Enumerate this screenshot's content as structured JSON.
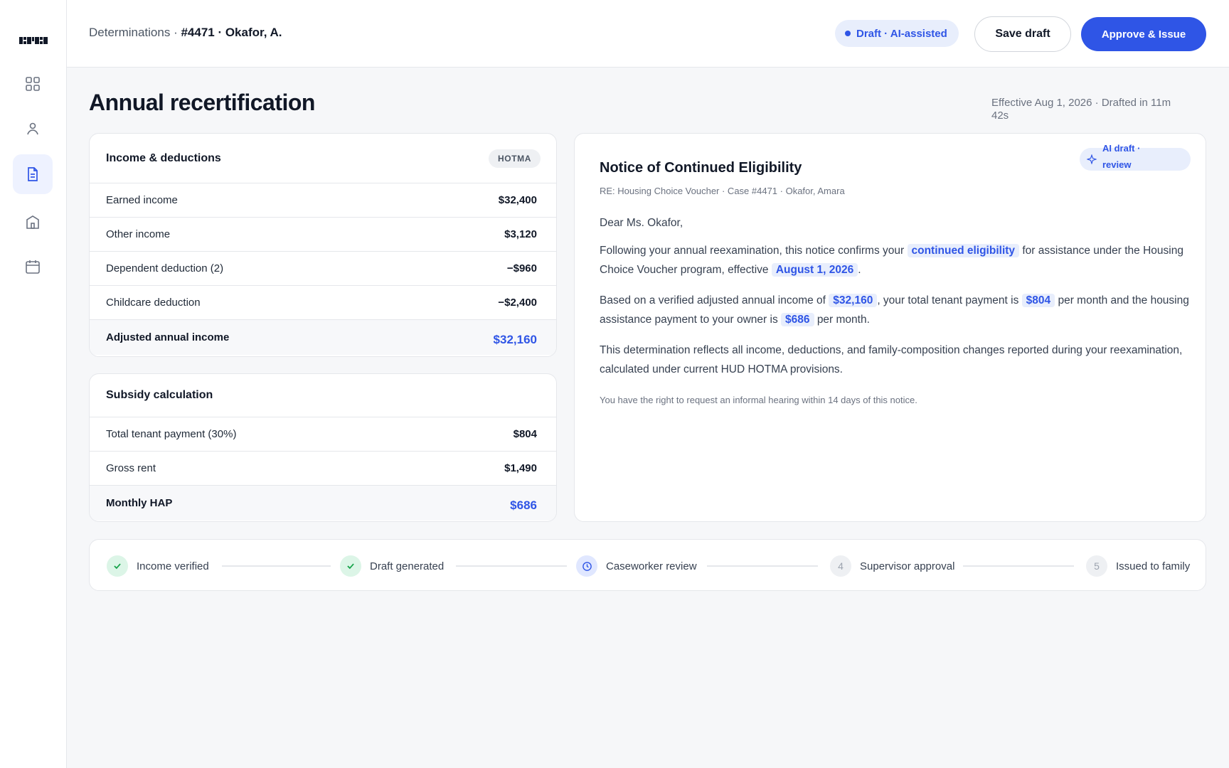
{
  "breadcrumb": {
    "section": "Determinations",
    "case": "#4471 · Okafor, A."
  },
  "header": {
    "status": "Draft · AI-assisted",
    "save_label": "Save draft",
    "approve_label": "Approve & Issue"
  },
  "page": {
    "title": "Annual recertification",
    "meta": "Effective Aug 1, 2026 · Drafted in 11m 42s"
  },
  "income": {
    "title": "Income & deductions",
    "tag": "HOTMA",
    "rows": [
      {
        "label": "Earned income",
        "value": "$32,400"
      },
      {
        "label": "Other income",
        "value": "$3,120"
      },
      {
        "label": "Dependent deduction (2)",
        "value": "−$960"
      },
      {
        "label": "Childcare deduction",
        "value": "−$2,400"
      }
    ],
    "total": {
      "label": "Adjusted annual income",
      "value": "$32,160"
    }
  },
  "subsidy": {
    "title": "Subsidy calculation",
    "rows": [
      {
        "label": "Total tenant payment (30%)",
        "value": "$804"
      },
      {
        "label": "Gross rent",
        "value": "$1,490"
      }
    ],
    "total": {
      "label": "Monthly HAP",
      "value": "$686"
    }
  },
  "notice": {
    "title": "Notice of Continued Eligibility",
    "badge": "AI draft · review",
    "re": "RE: Housing Choice Voucher · Case #4471 · Okafor, Amara",
    "salutation": "Dear Ms. Okafor,",
    "p1_a": "Following your annual reexamination, this notice confirms your",
    "p1_hl1": "continued eligibility",
    "p1_b": "for assistance under the Housing Choice Voucher program, effective",
    "p1_hl2": "August 1, 2026",
    "p1_c": ".",
    "p2_a": "Based on a verified adjusted annual income of",
    "p2_hl1": "$32,160",
    "p2_b": ", your total tenant payment is",
    "p2_hl2": "$804",
    "p2_c": "per month and the housing assistance payment to your owner is",
    "p2_hl3": "$686",
    "p2_d": "per month.",
    "p3": "This determination reflects all income, deductions, and family-composition changes reported during your reexamination, calculated under current HUD HOTMA provisions.",
    "footer": "You have the right to request an informal hearing within 14 days of this notice."
  },
  "steps": [
    {
      "label": "Income verified",
      "state": "done",
      "icon": "check-icon"
    },
    {
      "label": "Draft generated",
      "state": "done",
      "icon": "check-icon"
    },
    {
      "label": "Caseworker review",
      "state": "current",
      "icon": "clock-icon"
    },
    {
      "label": "Supervisor approval",
      "state": "todo",
      "number": "4"
    },
    {
      "label": "Issued to family",
      "state": "todo",
      "number": "5"
    }
  ],
  "colors": {
    "accent": "#2f55e6",
    "accent_soft": "#e8eefc",
    "success": "#16a34a",
    "success_soft": "#dcf5e7"
  },
  "icons": [
    "logo-mark",
    "dashboard-icon",
    "person-icon",
    "document-icon",
    "building-icon",
    "calendar-icon"
  ]
}
